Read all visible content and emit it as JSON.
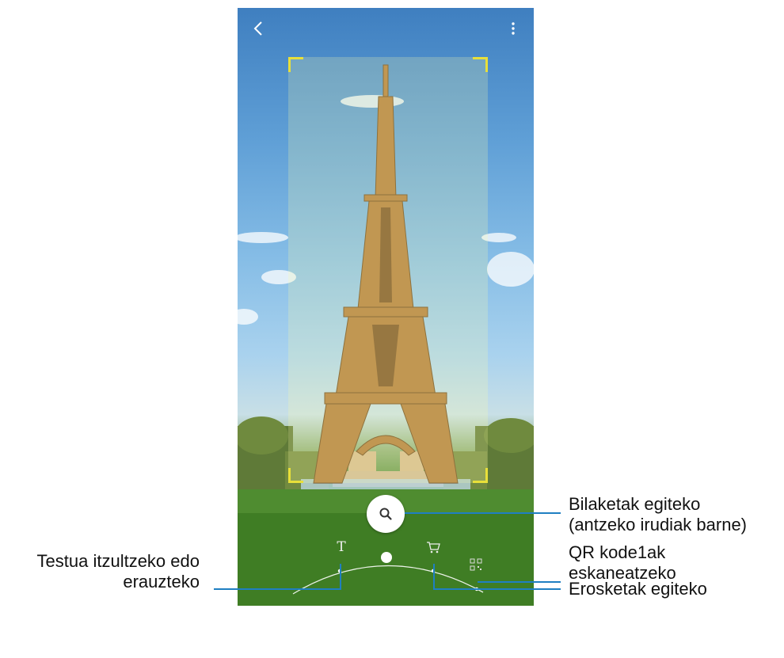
{
  "camera": {
    "back_icon": "chevron-left-icon",
    "more_icon": "kebab-menu-icon",
    "search_icon": "magnifier-icon",
    "modes": [
      {
        "name": "text",
        "icon": "text-t-icon",
        "glyph": "T"
      },
      {
        "name": "shopping",
        "icon": "shopping-cart-icon"
      },
      {
        "name": "qr",
        "icon": "qr-code-icon"
      }
    ],
    "frame_color": "#e8df3a"
  },
  "callouts": {
    "search": {
      "line1": "Bilaketak egiteko",
      "line2": "(antzeko irudiak barne)"
    },
    "qr": {
      "line1": "QR kode1ak",
      "line2": "eskaneatzeko"
    },
    "shopping": {
      "line1": "Erosketak egiteko"
    },
    "text": {
      "line1": "Testua itzultzeko edo",
      "line2": "erauzteko"
    },
    "line_color": "#1f7fc2"
  }
}
